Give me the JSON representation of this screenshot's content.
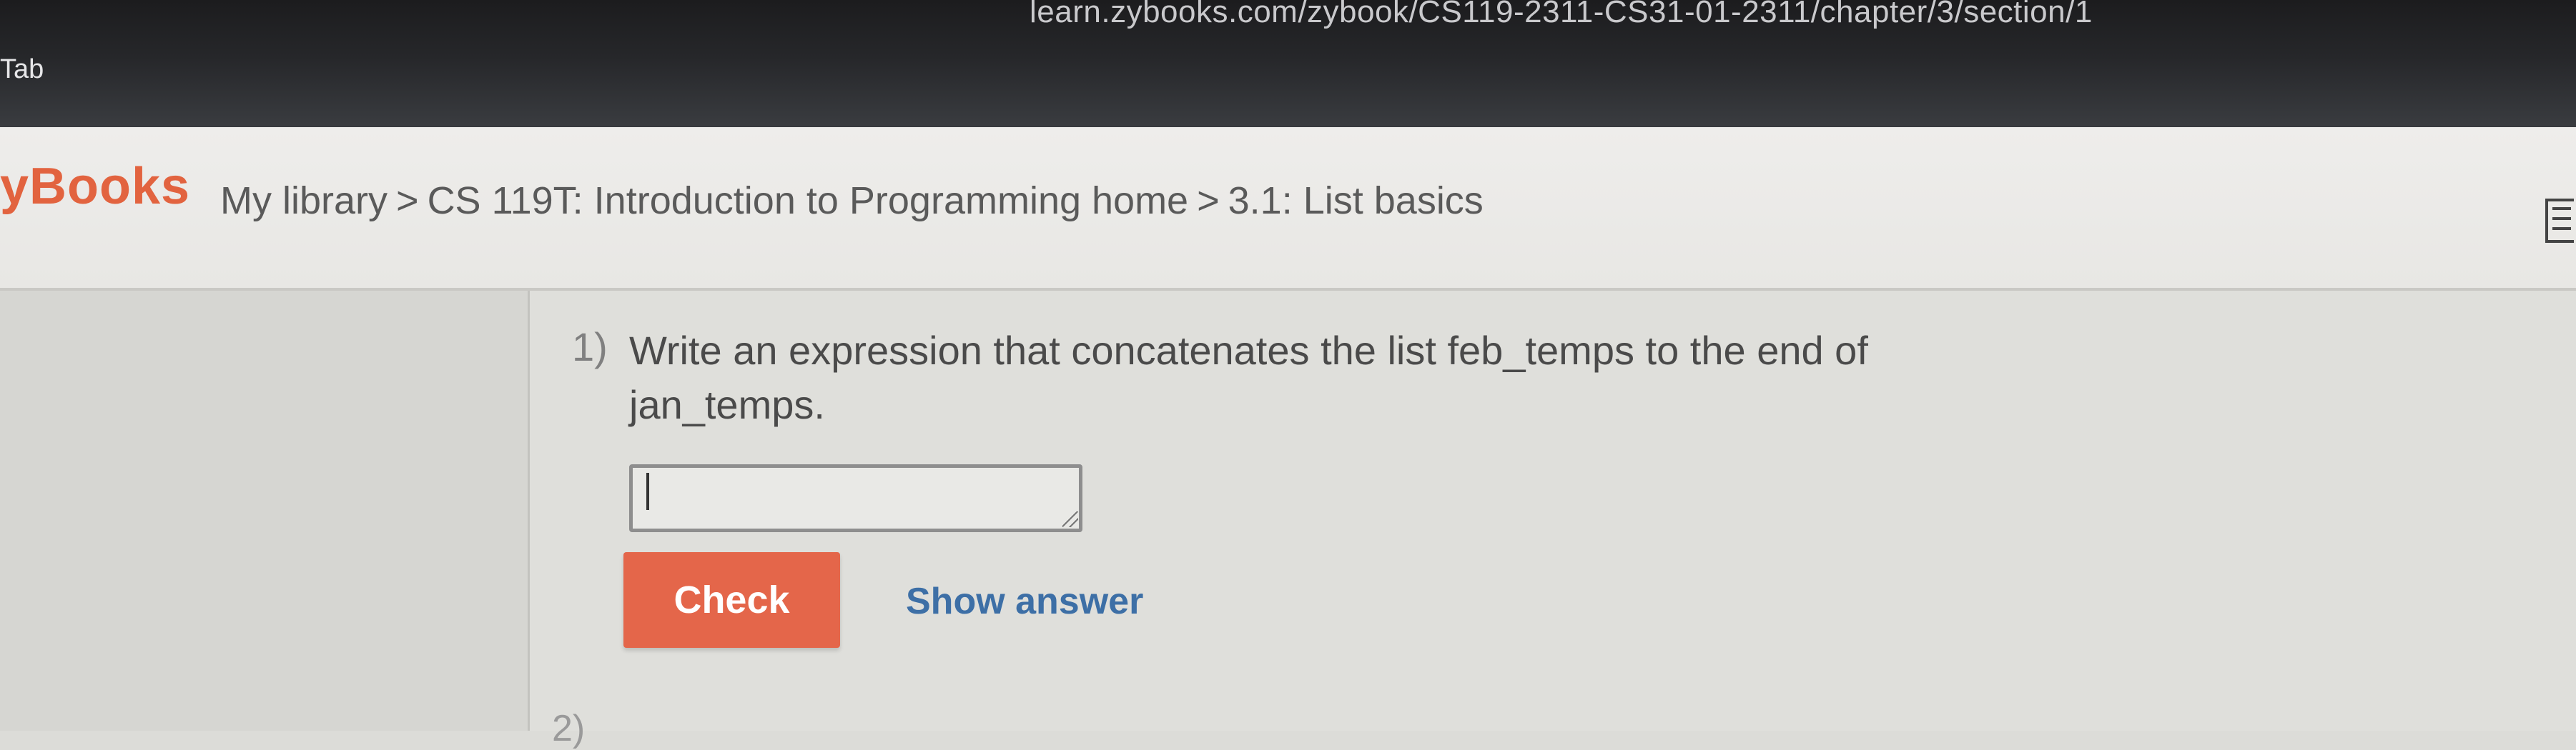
{
  "browser": {
    "url": "learn.zybooks.com/zybook/CS119-2311-CS31-01-2311/chapter/3/section/1",
    "tab_label": "Tab"
  },
  "header": {
    "logo": "yBooks",
    "breadcrumb": [
      "My library",
      "CS 119T: Introduction to Programming home",
      "3.1: List basics"
    ],
    "separator": ">"
  },
  "question": {
    "number": "1)",
    "text": "Write an expression that concatenates the list feb_temps to the end of jan_temps.",
    "input_value": "",
    "check_label": "Check",
    "show_answer_label": "Show answer"
  },
  "next_question_number": "2)",
  "colors": {
    "accent": "#e4664a",
    "link": "#3d6fa6",
    "logo": "#e2633f"
  }
}
